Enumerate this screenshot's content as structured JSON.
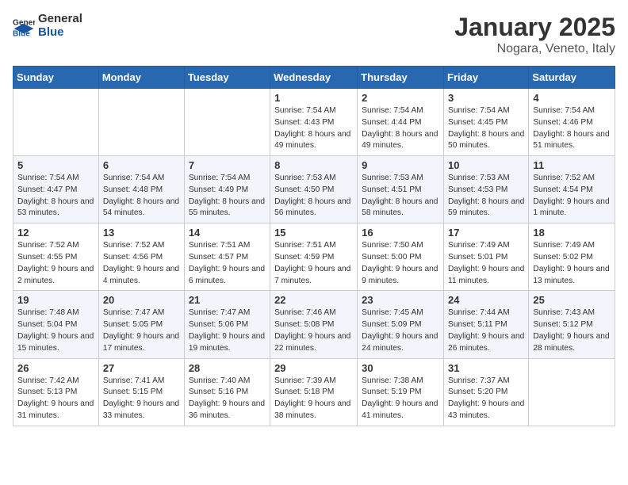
{
  "header": {
    "logo_general": "General",
    "logo_blue": "Blue",
    "month": "January 2025",
    "location": "Nogara, Veneto, Italy"
  },
  "weekdays": [
    "Sunday",
    "Monday",
    "Tuesday",
    "Wednesday",
    "Thursday",
    "Friday",
    "Saturday"
  ],
  "weeks": [
    [
      {
        "day": "",
        "sunrise": "",
        "sunset": "",
        "daylight": ""
      },
      {
        "day": "",
        "sunrise": "",
        "sunset": "",
        "daylight": ""
      },
      {
        "day": "",
        "sunrise": "",
        "sunset": "",
        "daylight": ""
      },
      {
        "day": "1",
        "sunrise": "Sunrise: 7:54 AM",
        "sunset": "Sunset: 4:43 PM",
        "daylight": "Daylight: 8 hours and 49 minutes."
      },
      {
        "day": "2",
        "sunrise": "Sunrise: 7:54 AM",
        "sunset": "Sunset: 4:44 PM",
        "daylight": "Daylight: 8 hours and 49 minutes."
      },
      {
        "day": "3",
        "sunrise": "Sunrise: 7:54 AM",
        "sunset": "Sunset: 4:45 PM",
        "daylight": "Daylight: 8 hours and 50 minutes."
      },
      {
        "day": "4",
        "sunrise": "Sunrise: 7:54 AM",
        "sunset": "Sunset: 4:46 PM",
        "daylight": "Daylight: 8 hours and 51 minutes."
      }
    ],
    [
      {
        "day": "5",
        "sunrise": "Sunrise: 7:54 AM",
        "sunset": "Sunset: 4:47 PM",
        "daylight": "Daylight: 8 hours and 53 minutes."
      },
      {
        "day": "6",
        "sunrise": "Sunrise: 7:54 AM",
        "sunset": "Sunset: 4:48 PM",
        "daylight": "Daylight: 8 hours and 54 minutes."
      },
      {
        "day": "7",
        "sunrise": "Sunrise: 7:54 AM",
        "sunset": "Sunset: 4:49 PM",
        "daylight": "Daylight: 8 hours and 55 minutes."
      },
      {
        "day": "8",
        "sunrise": "Sunrise: 7:53 AM",
        "sunset": "Sunset: 4:50 PM",
        "daylight": "Daylight: 8 hours and 56 minutes."
      },
      {
        "day": "9",
        "sunrise": "Sunrise: 7:53 AM",
        "sunset": "Sunset: 4:51 PM",
        "daylight": "Daylight: 8 hours and 58 minutes."
      },
      {
        "day": "10",
        "sunrise": "Sunrise: 7:53 AM",
        "sunset": "Sunset: 4:53 PM",
        "daylight": "Daylight: 8 hours and 59 minutes."
      },
      {
        "day": "11",
        "sunrise": "Sunrise: 7:52 AM",
        "sunset": "Sunset: 4:54 PM",
        "daylight": "Daylight: 9 hours and 1 minute."
      }
    ],
    [
      {
        "day": "12",
        "sunrise": "Sunrise: 7:52 AM",
        "sunset": "Sunset: 4:55 PM",
        "daylight": "Daylight: 9 hours and 2 minutes."
      },
      {
        "day": "13",
        "sunrise": "Sunrise: 7:52 AM",
        "sunset": "Sunset: 4:56 PM",
        "daylight": "Daylight: 9 hours and 4 minutes."
      },
      {
        "day": "14",
        "sunrise": "Sunrise: 7:51 AM",
        "sunset": "Sunset: 4:57 PM",
        "daylight": "Daylight: 9 hours and 6 minutes."
      },
      {
        "day": "15",
        "sunrise": "Sunrise: 7:51 AM",
        "sunset": "Sunset: 4:59 PM",
        "daylight": "Daylight: 9 hours and 7 minutes."
      },
      {
        "day": "16",
        "sunrise": "Sunrise: 7:50 AM",
        "sunset": "Sunset: 5:00 PM",
        "daylight": "Daylight: 9 hours and 9 minutes."
      },
      {
        "day": "17",
        "sunrise": "Sunrise: 7:49 AM",
        "sunset": "Sunset: 5:01 PM",
        "daylight": "Daylight: 9 hours and 11 minutes."
      },
      {
        "day": "18",
        "sunrise": "Sunrise: 7:49 AM",
        "sunset": "Sunset: 5:02 PM",
        "daylight": "Daylight: 9 hours and 13 minutes."
      }
    ],
    [
      {
        "day": "19",
        "sunrise": "Sunrise: 7:48 AM",
        "sunset": "Sunset: 5:04 PM",
        "daylight": "Daylight: 9 hours and 15 minutes."
      },
      {
        "day": "20",
        "sunrise": "Sunrise: 7:47 AM",
        "sunset": "Sunset: 5:05 PM",
        "daylight": "Daylight: 9 hours and 17 minutes."
      },
      {
        "day": "21",
        "sunrise": "Sunrise: 7:47 AM",
        "sunset": "Sunset: 5:06 PM",
        "daylight": "Daylight: 9 hours and 19 minutes."
      },
      {
        "day": "22",
        "sunrise": "Sunrise: 7:46 AM",
        "sunset": "Sunset: 5:08 PM",
        "daylight": "Daylight: 9 hours and 22 minutes."
      },
      {
        "day": "23",
        "sunrise": "Sunrise: 7:45 AM",
        "sunset": "Sunset: 5:09 PM",
        "daylight": "Daylight: 9 hours and 24 minutes."
      },
      {
        "day": "24",
        "sunrise": "Sunrise: 7:44 AM",
        "sunset": "Sunset: 5:11 PM",
        "daylight": "Daylight: 9 hours and 26 minutes."
      },
      {
        "day": "25",
        "sunrise": "Sunrise: 7:43 AM",
        "sunset": "Sunset: 5:12 PM",
        "daylight": "Daylight: 9 hours and 28 minutes."
      }
    ],
    [
      {
        "day": "26",
        "sunrise": "Sunrise: 7:42 AM",
        "sunset": "Sunset: 5:13 PM",
        "daylight": "Daylight: 9 hours and 31 minutes."
      },
      {
        "day": "27",
        "sunrise": "Sunrise: 7:41 AM",
        "sunset": "Sunset: 5:15 PM",
        "daylight": "Daylight: 9 hours and 33 minutes."
      },
      {
        "day": "28",
        "sunrise": "Sunrise: 7:40 AM",
        "sunset": "Sunset: 5:16 PM",
        "daylight": "Daylight: 9 hours and 36 minutes."
      },
      {
        "day": "29",
        "sunrise": "Sunrise: 7:39 AM",
        "sunset": "Sunset: 5:18 PM",
        "daylight": "Daylight: 9 hours and 38 minutes."
      },
      {
        "day": "30",
        "sunrise": "Sunrise: 7:38 AM",
        "sunset": "Sunset: 5:19 PM",
        "daylight": "Daylight: 9 hours and 41 minutes."
      },
      {
        "day": "31",
        "sunrise": "Sunrise: 7:37 AM",
        "sunset": "Sunset: 5:20 PM",
        "daylight": "Daylight: 9 hours and 43 minutes."
      },
      {
        "day": "",
        "sunrise": "",
        "sunset": "",
        "daylight": ""
      }
    ]
  ]
}
